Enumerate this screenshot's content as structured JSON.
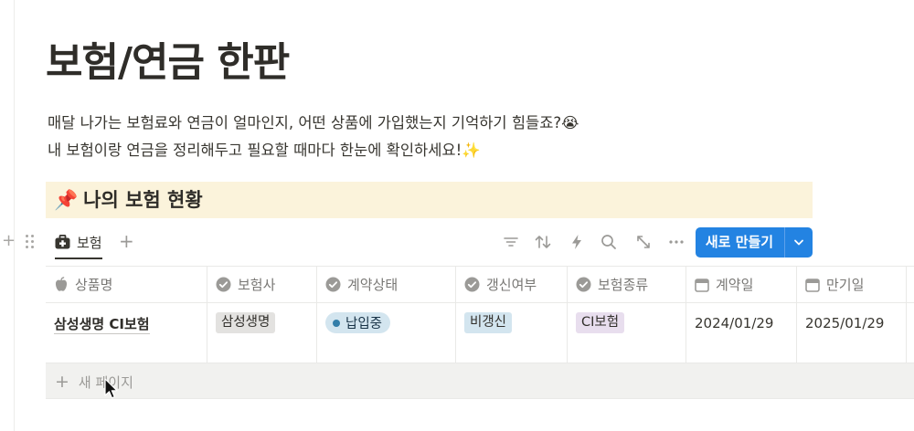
{
  "page": {
    "title": "보험/연금 한판",
    "intro_lines": [
      "매달 나가는 보험료와 연금이 얼마인지, 어떤 상품에 가입했는지 기억하기 힘들죠?😭",
      "내 보험이랑 연금을 정리해두고 필요할 때마다 한눈에 확인하세요!✨"
    ]
  },
  "callout": {
    "icon": "📌",
    "heading": "나의 보험 현황"
  },
  "database": {
    "view_icon": "first-aid-kit-icon",
    "view_tab": "보험",
    "toolbar_icons": [
      "filter-icon",
      "sort-icon",
      "automation-bolt-icon",
      "search-icon",
      "expand-icon",
      "more-icon"
    ],
    "new_button": "새로 만들기",
    "columns": [
      {
        "icon": "apple-icon",
        "label": "상품명"
      },
      {
        "icon": "check-circle-icon",
        "label": "보험사"
      },
      {
        "icon": "check-circle-icon",
        "label": "계약상태"
      },
      {
        "icon": "check-circle-icon",
        "label": "갱신여부"
      },
      {
        "icon": "check-circle-icon",
        "label": "보험종류"
      },
      {
        "icon": "calendar-icon",
        "label": "계약일"
      },
      {
        "icon": "calendar-icon",
        "label": "만기일"
      }
    ],
    "rows": [
      {
        "name": "삼성생명 CI보험",
        "company": "삼성생명",
        "status": "납입중",
        "renewal": "비갱신",
        "type": "CI보험",
        "start_date": "2024/01/29",
        "end_date": "2025/01/29"
      }
    ],
    "new_page": "새 페이지"
  },
  "colors": {
    "accent": "#2383e2",
    "callout_bg": "#fbf3db",
    "tag_gray": "#e3e2e0",
    "tag_blue": "#d3e5ef",
    "tag_purple": "#e8deee"
  }
}
